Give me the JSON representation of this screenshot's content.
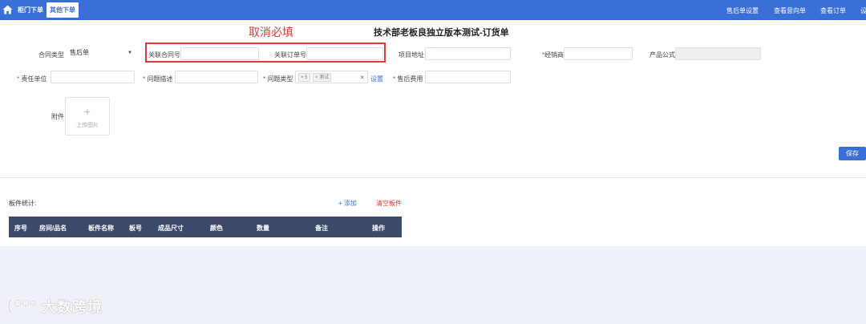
{
  "topbar": {
    "tabs": [
      "柜门下单",
      "其他下单"
    ],
    "nav": [
      "售后单设置",
      "查看意向单",
      "查看订单",
      "设"
    ],
    "accent": "#3a6fd8"
  },
  "annotation": "取消必填",
  "title": "技术部老板良独立版本测试-订货单",
  "form": {
    "contract_type_label": "合同类型",
    "contract_type_value": "售后单",
    "related_contract_label": "关联合同号",
    "related_order_label": "关联订单号",
    "project_address_label": "项目地址",
    "dealer_label": "经销商",
    "product_formula_label": "产品公式",
    "responsible_unit_label": "责任单位",
    "issue_desc_label": "问题描述",
    "issue_type_label": "问题类型",
    "issue_type_tag1": "× 5",
    "issue_type_tag2": "× 测试",
    "issue_type_clear": "×",
    "settings_link": "设置",
    "aftersale_fee_label": "售后费用",
    "attachment_label": "附件",
    "upload_plus": "+",
    "upload_text": "上传图片"
  },
  "save_label": "保存",
  "boards": {
    "stats_label": "板件统计:",
    "add_label": "+ 添加",
    "clear_label": "清空板件",
    "columns": [
      "序号",
      "房间/品名",
      "板件名称",
      "板号",
      "成品尺寸",
      "颜色",
      "数量",
      "备注",
      "操作"
    ]
  },
  "watermark": "大数跨境",
  "required_mark": "*"
}
